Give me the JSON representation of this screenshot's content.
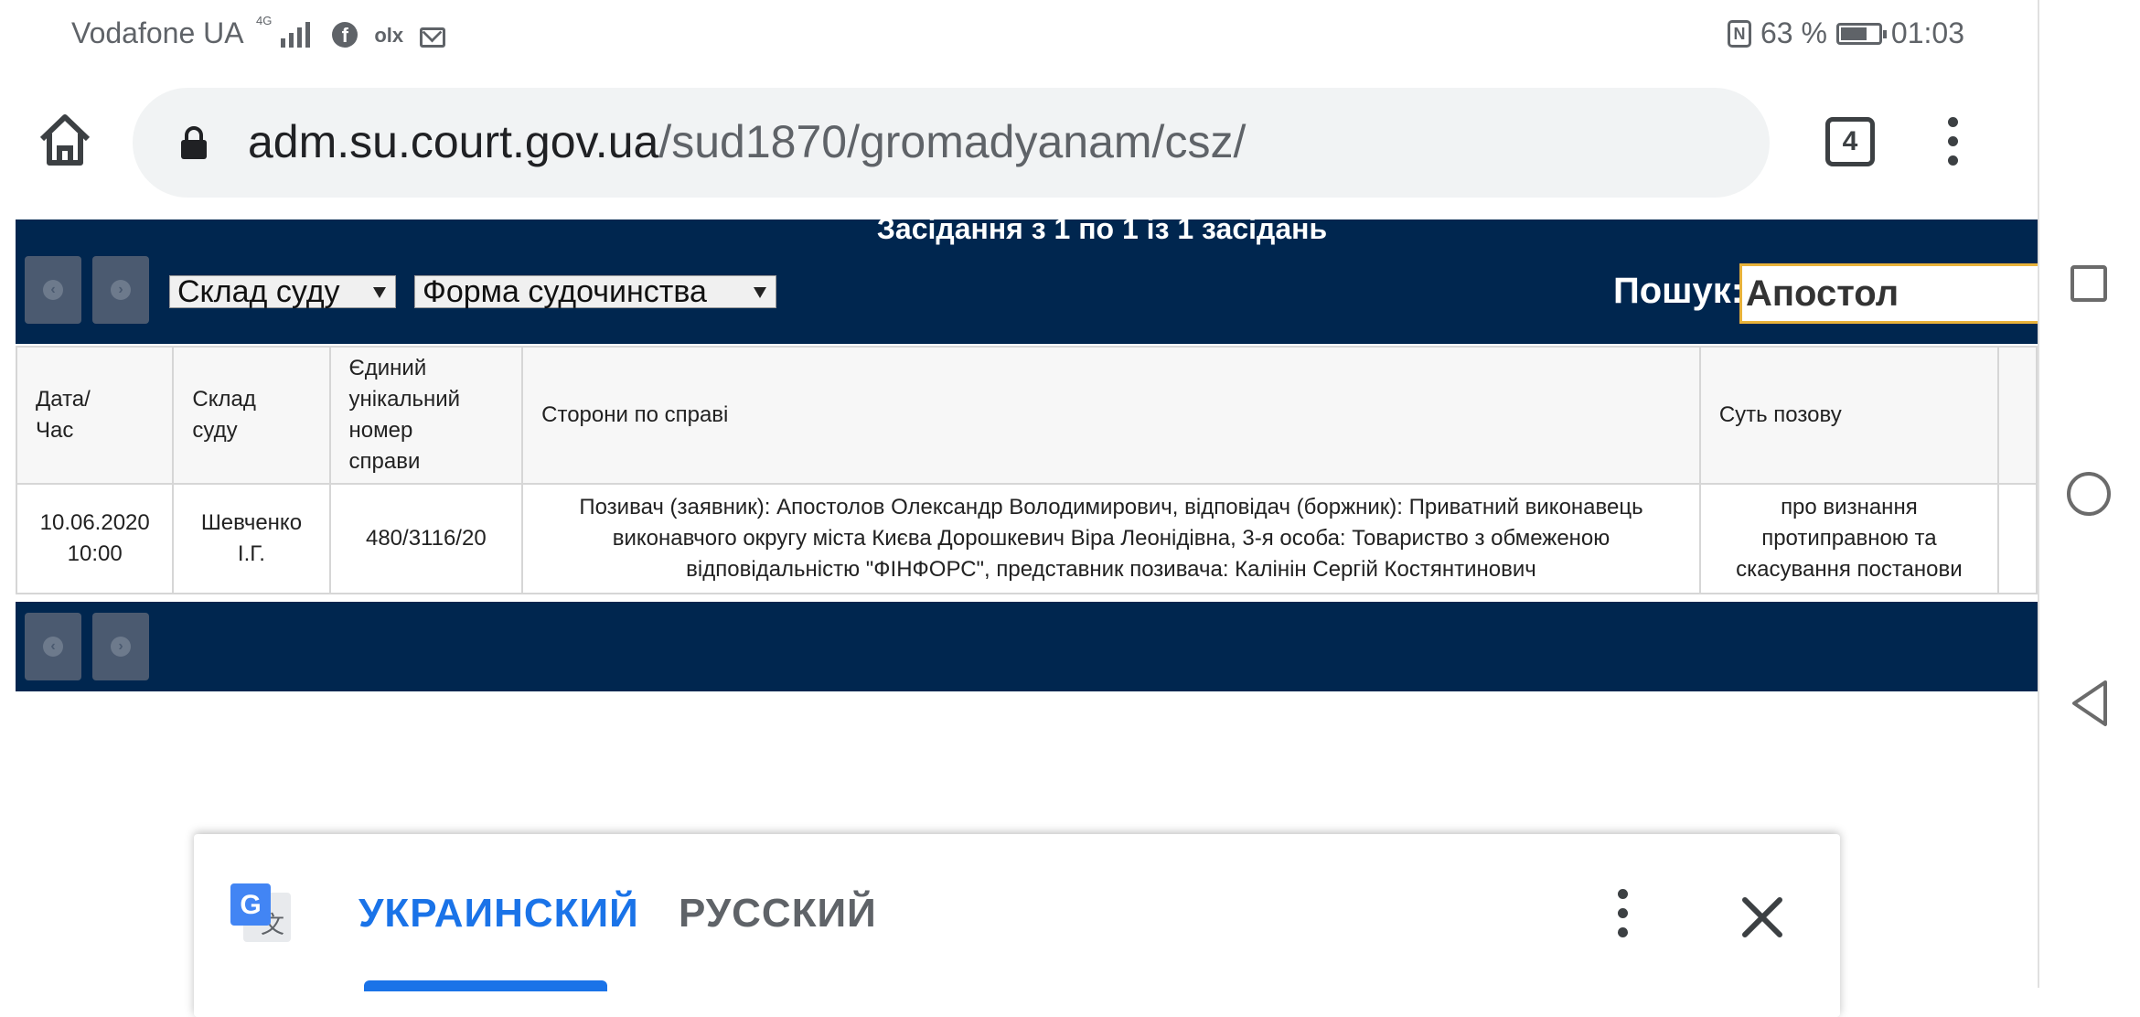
{
  "status_bar": {
    "carrier": "Vodafone UA",
    "network_gen": "4G",
    "notification_icons": [
      "facebook-icon",
      "olx-icon",
      "mail-icon"
    ],
    "nfc": "N",
    "battery_percent": "63 %",
    "battery_level": 0.63,
    "time": "01:03"
  },
  "browser": {
    "url_host": "adm.su.court.gov.ua",
    "url_path": "/sud1870/gromadyanam/csz/",
    "tab_count": "4"
  },
  "page": {
    "caption": "Засідання з 1 по 1 із 1 засідань",
    "filter_composition": "Склад суду",
    "filter_procedure": "Форма судочинства",
    "search_label": "Пошук:",
    "search_value": "Апостол",
    "table": {
      "headers": [
        [
          "Дата/",
          "Час"
        ],
        [
          "Склад",
          "суду"
        ],
        [
          "Єдиний",
          "унікальний",
          "номер",
          "справи"
        ],
        [
          "Сторони по справі"
        ],
        [
          "Суть позову"
        ]
      ],
      "rows": [
        {
          "date": "10.06.2020",
          "time": "10:00",
          "judge_1": "Шевченко",
          "judge_2": "І.Г.",
          "case_number": "480/3116/20",
          "parties_1": "Позивач (заявник): Апостолов Олександр Володимирович, відповідач (боржник): Приватний виконавець",
          "parties_2": "виконавчого округу міста Києва Дорошкевич Віра Леонідівна, 3-я особа: Товариство з обмеженою",
          "parties_3": "відповідальністю \"ФІНФОРС\", представник позивача: Калінін Сергій Костянтинович",
          "subject_1": "про визнання",
          "subject_2": "протиправною та",
          "subject_3": "скасування постанови"
        }
      ]
    }
  },
  "translate_bar": {
    "active_language": "УКРАИНСКИЙ",
    "other_language": "РУССКИЙ"
  },
  "colors": {
    "navy": "#00264f",
    "accent_blue": "#1a73e8",
    "search_border": "#e8b23a"
  }
}
